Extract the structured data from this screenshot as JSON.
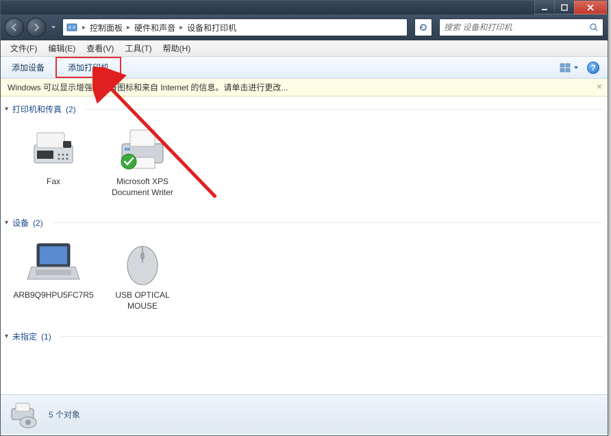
{
  "breadcrumb": {
    "items": [
      "控制面板",
      "硬件和声音",
      "设备和打印机"
    ]
  },
  "search": {
    "placeholder": "搜索 设备和打印机"
  },
  "menubar": {
    "file": "文件(F)",
    "edit": "编辑(E)",
    "view": "查看(V)",
    "tools": "工具(T)",
    "help": "帮助(H)"
  },
  "cmdbar": {
    "add_device": "添加设备",
    "add_printer": "添加打印机"
  },
  "infobar": {
    "text": "Windows 可以显示增强型设备图标和来自 Internet 的信息。请单击进行更改..."
  },
  "groups": [
    {
      "title": "打印机和传真",
      "count": "(2)",
      "items": [
        {
          "icon": "fax",
          "label": "Fax"
        },
        {
          "icon": "printer-default",
          "label": "Microsoft XPS Document Writer"
        }
      ]
    },
    {
      "title": "设备",
      "count": "(2)",
      "items": [
        {
          "icon": "laptop",
          "label": "ARB9Q9HPU5FC7R5"
        },
        {
          "icon": "mouse",
          "label": "USB OPTICAL MOUSE"
        }
      ]
    },
    {
      "title": "未指定",
      "count": "(1)",
      "items": []
    }
  ],
  "statusbar": {
    "text": "5 个对象"
  }
}
